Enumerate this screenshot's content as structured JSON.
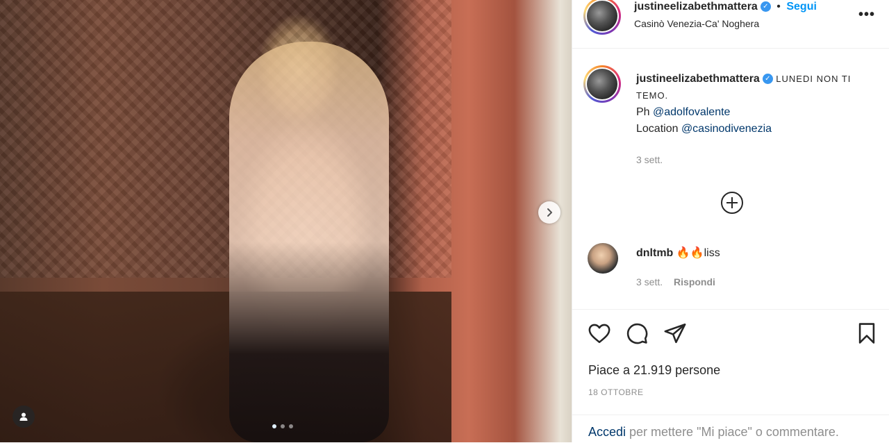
{
  "post": {
    "username": "justineelizabethmattera",
    "follow_label": "Segui",
    "separator": "•",
    "location": "Casinò Venezia-Ca' Noghera",
    "caption_text": "LUNEDI NON TI TEMO.",
    "caption_ph_prefix": "Ph ",
    "caption_ph_mention": "@adolfovalente",
    "caption_loc_prefix": "Location ",
    "caption_loc_mention": "@casinodivenezia",
    "caption_time": "3 sett.",
    "more_label": "•••"
  },
  "comment": {
    "username": "dnltmb",
    "text": "🔥🔥liss",
    "time": "3 sett.",
    "reply_label": "Rispondi"
  },
  "stats": {
    "likes_label": "Piace a 21.919 persone",
    "date": "18 OTTOBRE"
  },
  "login": {
    "link": "Accedi",
    "rest": " per mettere \"Mi piace\" o commentare."
  },
  "carousel": {
    "current": 1,
    "total": 3
  },
  "icons": [
    "heart-icon",
    "comment-icon",
    "share-icon",
    "bookmark-icon",
    "plus-circle-icon",
    "chevron-right-icon",
    "user-tag-icon",
    "verified-icon"
  ],
  "colors": {
    "link": "#00376b",
    "follow": "#0095f6",
    "verified": "#3897f0",
    "muted": "#8e8e8e"
  }
}
